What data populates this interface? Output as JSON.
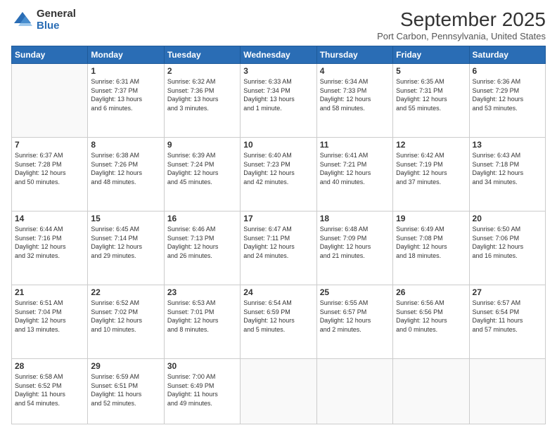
{
  "logo": {
    "general": "General",
    "blue": "Blue"
  },
  "header": {
    "month": "September 2025",
    "location": "Port Carbon, Pennsylvania, United States"
  },
  "weekdays": [
    "Sunday",
    "Monday",
    "Tuesday",
    "Wednesday",
    "Thursday",
    "Friday",
    "Saturday"
  ],
  "weeks": [
    [
      {
        "day": "",
        "info": ""
      },
      {
        "day": "1",
        "info": "Sunrise: 6:31 AM\nSunset: 7:37 PM\nDaylight: 13 hours\nand 6 minutes."
      },
      {
        "day": "2",
        "info": "Sunrise: 6:32 AM\nSunset: 7:36 PM\nDaylight: 13 hours\nand 3 minutes."
      },
      {
        "day": "3",
        "info": "Sunrise: 6:33 AM\nSunset: 7:34 PM\nDaylight: 13 hours\nand 1 minute."
      },
      {
        "day": "4",
        "info": "Sunrise: 6:34 AM\nSunset: 7:33 PM\nDaylight: 12 hours\nand 58 minutes."
      },
      {
        "day": "5",
        "info": "Sunrise: 6:35 AM\nSunset: 7:31 PM\nDaylight: 12 hours\nand 55 minutes."
      },
      {
        "day": "6",
        "info": "Sunrise: 6:36 AM\nSunset: 7:29 PM\nDaylight: 12 hours\nand 53 minutes."
      }
    ],
    [
      {
        "day": "7",
        "info": "Sunrise: 6:37 AM\nSunset: 7:28 PM\nDaylight: 12 hours\nand 50 minutes."
      },
      {
        "day": "8",
        "info": "Sunrise: 6:38 AM\nSunset: 7:26 PM\nDaylight: 12 hours\nand 48 minutes."
      },
      {
        "day": "9",
        "info": "Sunrise: 6:39 AM\nSunset: 7:24 PM\nDaylight: 12 hours\nand 45 minutes."
      },
      {
        "day": "10",
        "info": "Sunrise: 6:40 AM\nSunset: 7:23 PM\nDaylight: 12 hours\nand 42 minutes."
      },
      {
        "day": "11",
        "info": "Sunrise: 6:41 AM\nSunset: 7:21 PM\nDaylight: 12 hours\nand 40 minutes."
      },
      {
        "day": "12",
        "info": "Sunrise: 6:42 AM\nSunset: 7:19 PM\nDaylight: 12 hours\nand 37 minutes."
      },
      {
        "day": "13",
        "info": "Sunrise: 6:43 AM\nSunset: 7:18 PM\nDaylight: 12 hours\nand 34 minutes."
      }
    ],
    [
      {
        "day": "14",
        "info": "Sunrise: 6:44 AM\nSunset: 7:16 PM\nDaylight: 12 hours\nand 32 minutes."
      },
      {
        "day": "15",
        "info": "Sunrise: 6:45 AM\nSunset: 7:14 PM\nDaylight: 12 hours\nand 29 minutes."
      },
      {
        "day": "16",
        "info": "Sunrise: 6:46 AM\nSunset: 7:13 PM\nDaylight: 12 hours\nand 26 minutes."
      },
      {
        "day": "17",
        "info": "Sunrise: 6:47 AM\nSunset: 7:11 PM\nDaylight: 12 hours\nand 24 minutes."
      },
      {
        "day": "18",
        "info": "Sunrise: 6:48 AM\nSunset: 7:09 PM\nDaylight: 12 hours\nand 21 minutes."
      },
      {
        "day": "19",
        "info": "Sunrise: 6:49 AM\nSunset: 7:08 PM\nDaylight: 12 hours\nand 18 minutes."
      },
      {
        "day": "20",
        "info": "Sunrise: 6:50 AM\nSunset: 7:06 PM\nDaylight: 12 hours\nand 16 minutes."
      }
    ],
    [
      {
        "day": "21",
        "info": "Sunrise: 6:51 AM\nSunset: 7:04 PM\nDaylight: 12 hours\nand 13 minutes."
      },
      {
        "day": "22",
        "info": "Sunrise: 6:52 AM\nSunset: 7:02 PM\nDaylight: 12 hours\nand 10 minutes."
      },
      {
        "day": "23",
        "info": "Sunrise: 6:53 AM\nSunset: 7:01 PM\nDaylight: 12 hours\nand 8 minutes."
      },
      {
        "day": "24",
        "info": "Sunrise: 6:54 AM\nSunset: 6:59 PM\nDaylight: 12 hours\nand 5 minutes."
      },
      {
        "day": "25",
        "info": "Sunrise: 6:55 AM\nSunset: 6:57 PM\nDaylight: 12 hours\nand 2 minutes."
      },
      {
        "day": "26",
        "info": "Sunrise: 6:56 AM\nSunset: 6:56 PM\nDaylight: 12 hours\nand 0 minutes."
      },
      {
        "day": "27",
        "info": "Sunrise: 6:57 AM\nSunset: 6:54 PM\nDaylight: 11 hours\nand 57 minutes."
      }
    ],
    [
      {
        "day": "28",
        "info": "Sunrise: 6:58 AM\nSunset: 6:52 PM\nDaylight: 11 hours\nand 54 minutes."
      },
      {
        "day": "29",
        "info": "Sunrise: 6:59 AM\nSunset: 6:51 PM\nDaylight: 11 hours\nand 52 minutes."
      },
      {
        "day": "30",
        "info": "Sunrise: 7:00 AM\nSunset: 6:49 PM\nDaylight: 11 hours\nand 49 minutes."
      },
      {
        "day": "",
        "info": ""
      },
      {
        "day": "",
        "info": ""
      },
      {
        "day": "",
        "info": ""
      },
      {
        "day": "",
        "info": ""
      }
    ]
  ]
}
